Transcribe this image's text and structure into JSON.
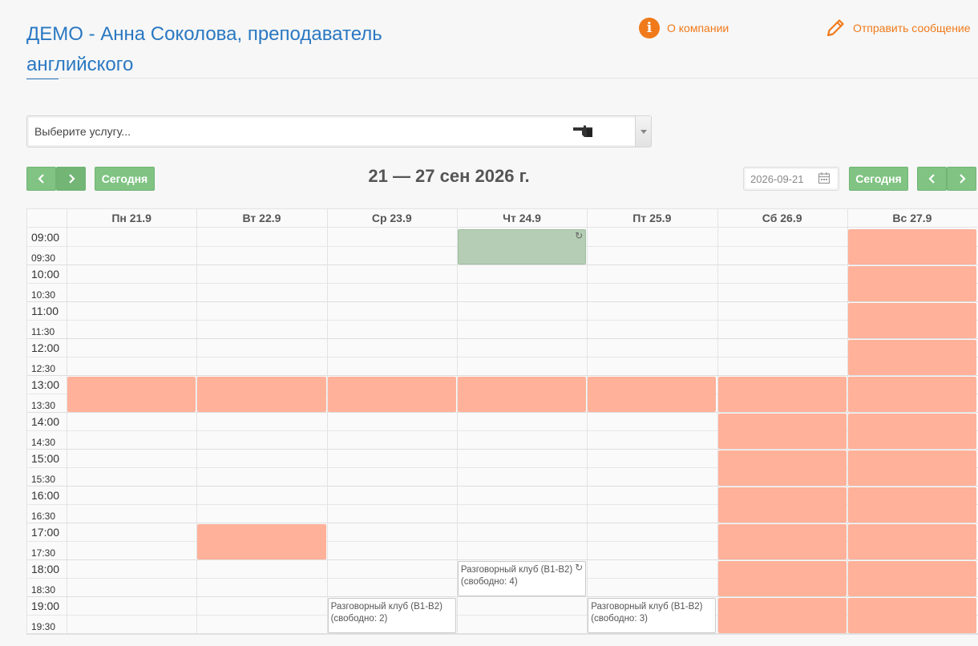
{
  "header": {
    "title": "ДЕМО - Анна Соколова, преподаватель английского",
    "about_label": "О компании",
    "message_label": "Отправить сообщение"
  },
  "service_select": {
    "placeholder": "Выберите услугу..."
  },
  "toolbar": {
    "prev": "‹",
    "next": "›",
    "today_label": "Сегодня",
    "range_title": "21 — 27 сен 2026 г.",
    "date_value": "2026-09-21"
  },
  "colors": {
    "accent": "#2a78c2",
    "orange": "#f07a1a",
    "button_green": "#80c383",
    "busy": "#ffb19a",
    "booked": "#b4cdb4"
  },
  "calendar": {
    "days": [
      "Пн 21.9",
      "Вт 22.9",
      "Ср 23.9",
      "Чт 24.9",
      "Пт 25.9",
      "Сб 26.9",
      "Вс 27.9"
    ],
    "times": [
      "09:00",
      "09:30",
      "10:00",
      "10:30",
      "11:00",
      "11:30",
      "12:00",
      "12:30",
      "13:00",
      "13:30",
      "14:00",
      "14:30",
      "15:00",
      "15:30",
      "16:00",
      "16:30",
      "17:00",
      "17:30",
      "18:00",
      "18:30",
      "19:00",
      "19:30"
    ],
    "refresh_glyph": "↻",
    "events": [
      {
        "day": 3,
        "line1": "Разговорный клуб (B1-B2)",
        "line2": "(свободно: 4)"
      },
      {
        "day": 2,
        "line1": "Разговорный клуб (B1-B2)",
        "line2": "(свободно: 2)"
      },
      {
        "day": 4,
        "line1": "Разговорный клуб (B1-B2)",
        "line2": "(свободно: 3)"
      }
    ]
  }
}
